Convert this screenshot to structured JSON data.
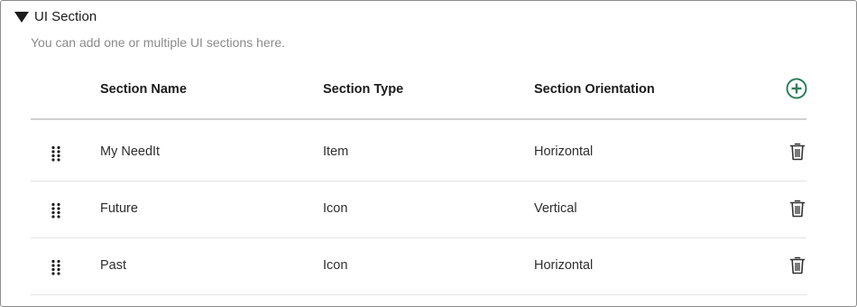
{
  "section": {
    "title": "UI Section",
    "description": "You can add one or multiple UI sections here."
  },
  "table": {
    "columns": [
      "Section Name",
      "Section Type",
      "Section Orientation"
    ],
    "rows": [
      {
        "name": "My NeedIt",
        "type": "Item",
        "orientation": "Horizontal"
      },
      {
        "name": "Future",
        "type": "Icon",
        "orientation": "Vertical"
      },
      {
        "name": "Past",
        "type": "Icon",
        "orientation": "Horizontal"
      }
    ]
  },
  "icons": {
    "toggle": "collapse-triangle-icon",
    "add": "add-circle-icon",
    "drag": "drag-handle-icon",
    "delete": "trash-icon"
  },
  "colors": {
    "accent": "#2e7d5b",
    "border": "#8c8c8c",
    "muted_text": "#8a8a8a"
  }
}
